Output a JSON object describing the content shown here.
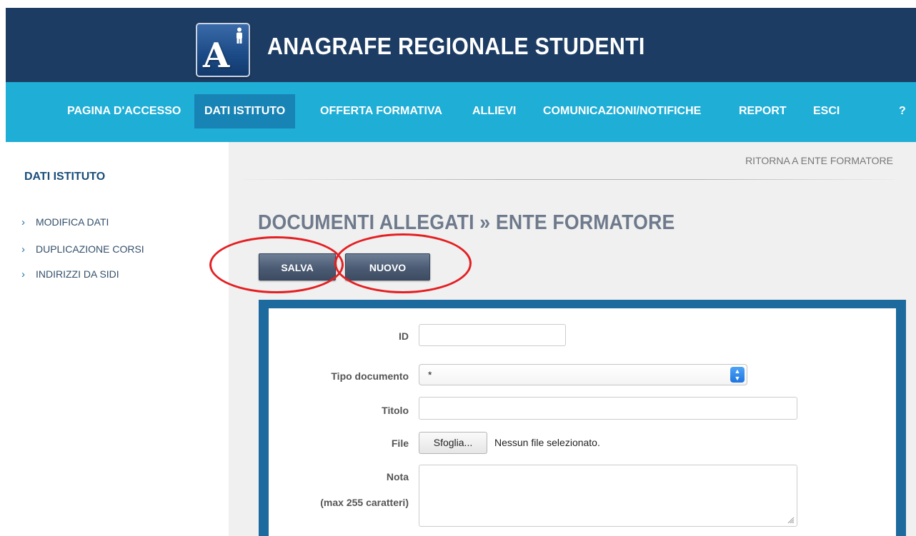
{
  "header": {
    "app_title": "ANAGRAFE REGIONALE STUDENTI",
    "logo_letter": "A"
  },
  "nav": {
    "items": [
      {
        "label": "PAGINA D'ACCESSO"
      },
      {
        "label": "DATI ISTITUTO",
        "active": true
      },
      {
        "label": "OFFERTA FORMATIVA"
      },
      {
        "label": "ALLIEVI"
      },
      {
        "label": "COMUNICAZIONI/NOTIFICHE"
      },
      {
        "label": "REPORT"
      },
      {
        "label": "ESCI"
      },
      {
        "label": "?"
      }
    ]
  },
  "sidebar": {
    "title": "DATI ISTITUTO",
    "links": [
      {
        "label": "MODIFICA DATI"
      },
      {
        "label": "DUPLICAZIONE CORSI"
      },
      {
        "label": "INDIRIZZI DA SIDI"
      }
    ]
  },
  "main": {
    "back_link": "RITORNA A ENTE FORMATORE",
    "page_title": "DOCUMENTI ALLEGATI » ENTE FORMATORE",
    "buttons": {
      "save": "SALVA",
      "new": "NUOVO"
    }
  },
  "form": {
    "id_label": "ID",
    "id_value": "",
    "tipo_label": "Tipo documento",
    "tipo_value": "*",
    "titolo_label": "Titolo",
    "titolo_value": "",
    "file_label": "File",
    "file_button": "Sfoglia...",
    "file_status": "Nessun file selezionato.",
    "nota_label": "Nota",
    "nota_hint": "(max 255 caratteri)",
    "nota_value": ""
  },
  "colors": {
    "header_bg": "#1d3c63",
    "nav_bg": "#1faed6",
    "nav_active": "#1883b5",
    "form_frame": "#1c6a9e",
    "highlight": "#e41f22"
  }
}
